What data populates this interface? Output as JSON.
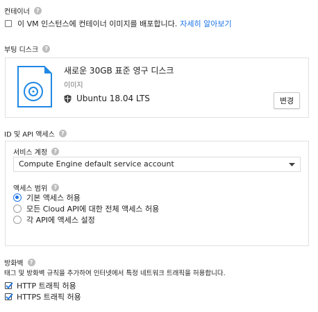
{
  "container": {
    "title": "컨테이너",
    "checkbox_label": "이 VM 인스턴스에 컨테이너 이미지를 배포합니다.",
    "learn_more": "자세히 알아보기",
    "checked": false
  },
  "boot_disk": {
    "title": "부팅 디스크",
    "disk_name": "새로운 30GB 표준 영구 디스크",
    "image_label": "이미지",
    "image_value": "Ubuntu 18.04 LTS",
    "change_button": "변경"
  },
  "identity": {
    "title": "ID 및 API 액세스",
    "service_account_label": "서비스 계정",
    "service_account_value": "Compute Engine default service account",
    "access_scope_label": "액세스 범위",
    "scopes": [
      {
        "label": "기본 액세스 허용",
        "selected": true
      },
      {
        "label": "모든 Cloud API에 대한 전체 액세스 허용",
        "selected": false
      },
      {
        "label": "각 API에 액세스 설정",
        "selected": false
      }
    ]
  },
  "firewall": {
    "title": "방화벽",
    "description": "태그 및 방화벽 규칙을 추가하여 인터넷에서 특정 네트워크 트래픽을 허용합니다.",
    "options": [
      {
        "label": "HTTP 트래픽 허용",
        "checked": true
      },
      {
        "label": "HTTPS 트래픽 허용",
        "checked": true
      }
    ]
  },
  "colors": {
    "accent": "#1a73e8",
    "help_icon": "#bdbdbd",
    "border": "#e0e0e0"
  }
}
